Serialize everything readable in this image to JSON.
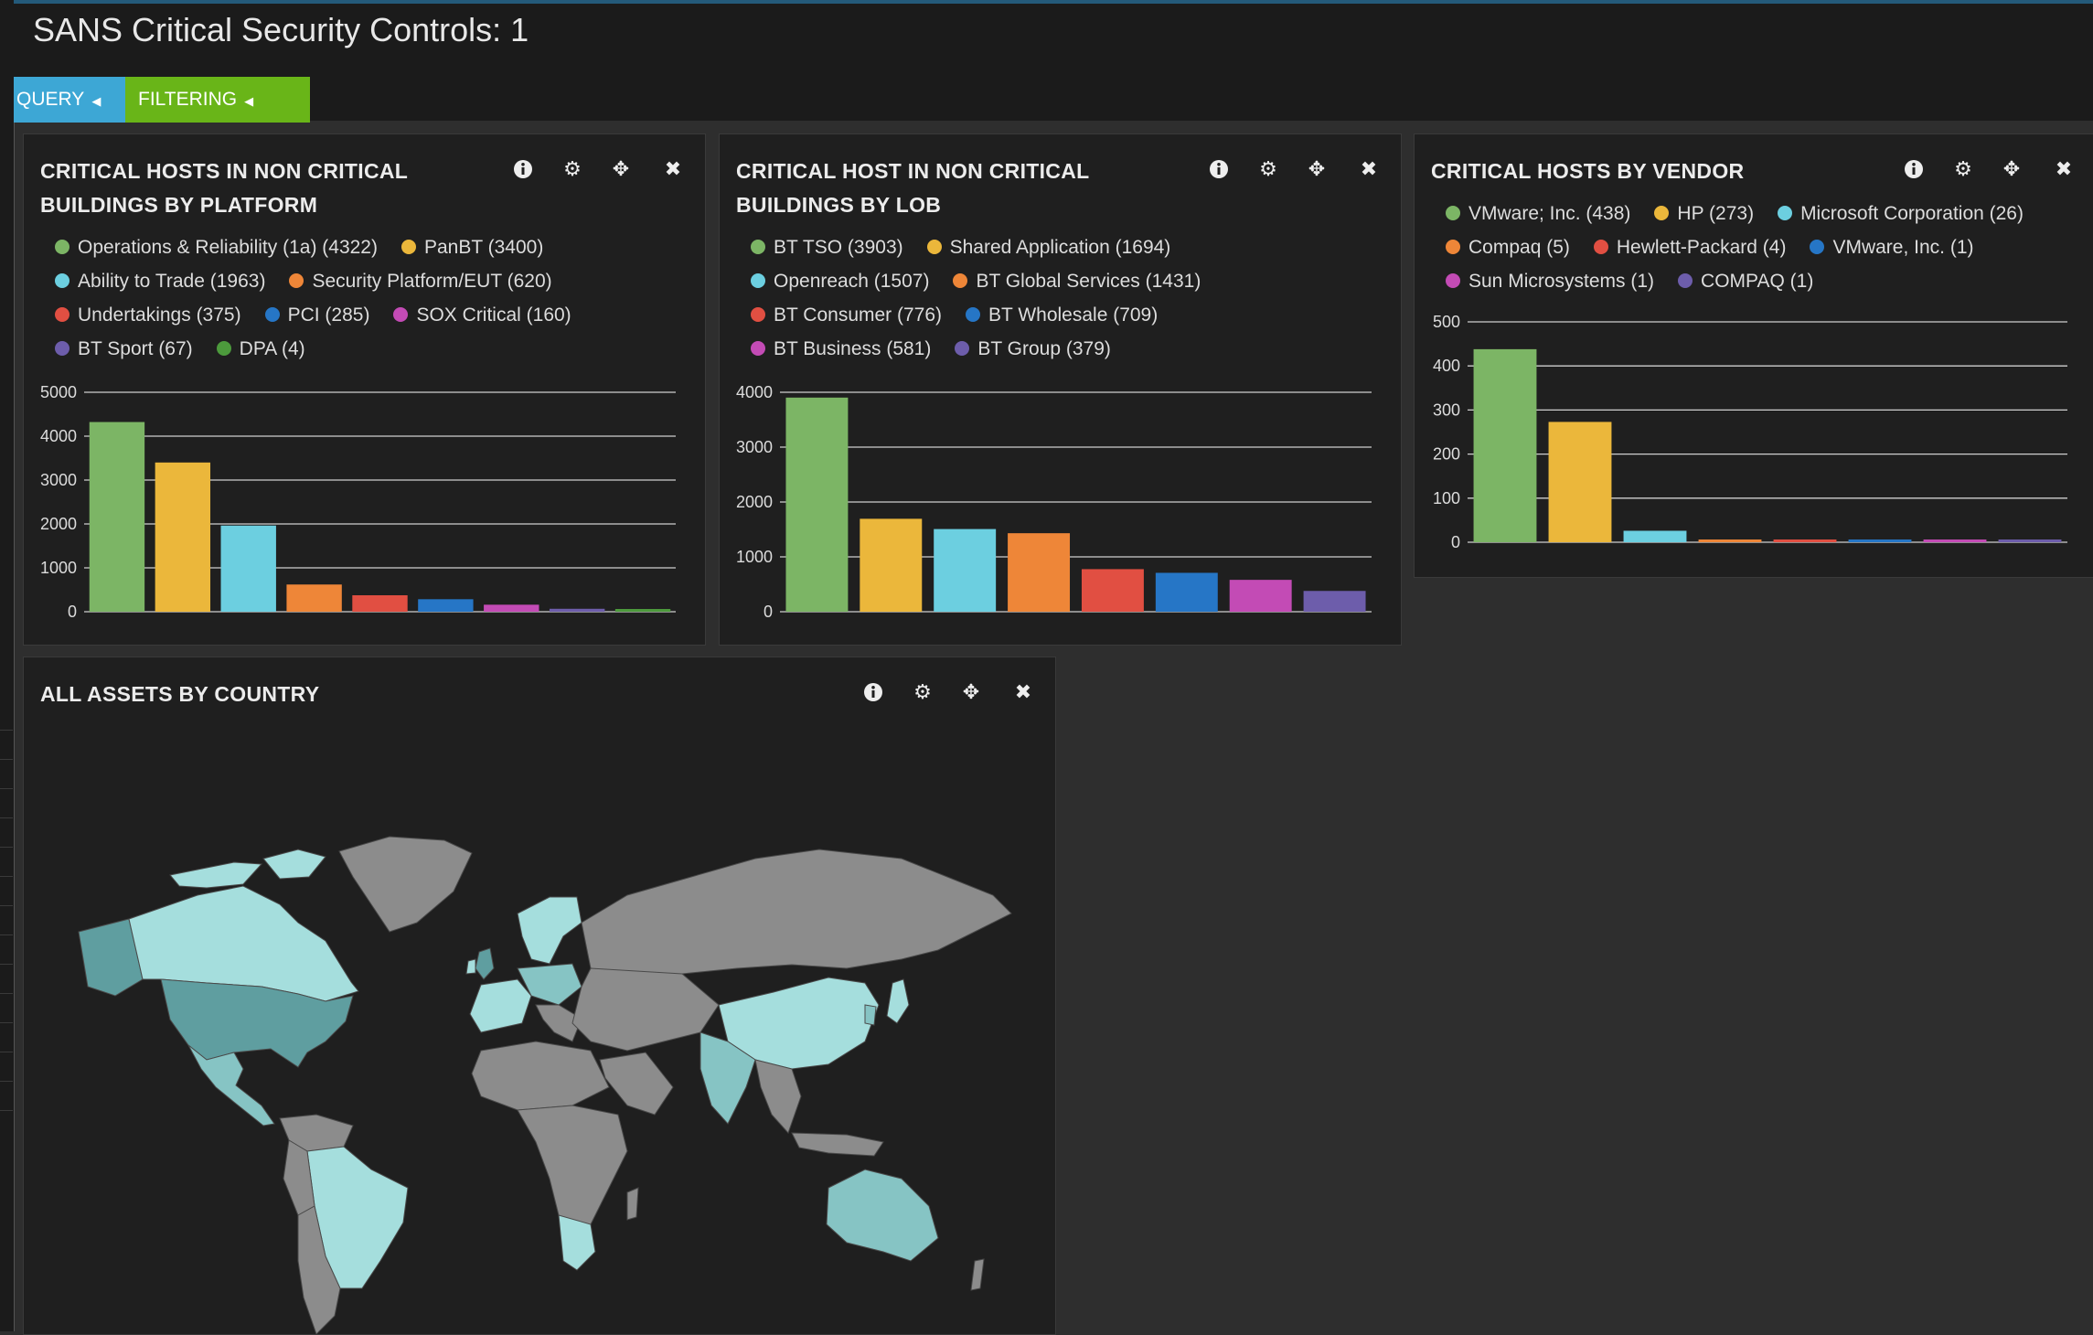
{
  "page": {
    "title": "SANS Critical Security Controls: 1"
  },
  "toolbar": {
    "query_label": "QUERY",
    "filtering_label": "FILTERING"
  },
  "colors": {
    "query": "#3da7d5",
    "filtering": "#69b518"
  },
  "panels": [
    {
      "id": "platform",
      "title_line1": "CRITICAL HOSTS IN NON CRITICAL",
      "title_line2": "BUILDINGS BY PLATFORM",
      "legend": [
        {
          "label": "Operations & Reliability (1a) (4322)",
          "color": "#7cb565"
        },
        {
          "label": "PanBT (3400)",
          "color": "#ebb73b"
        },
        {
          "label": "Ability to Trade (1963)",
          "color": "#6ccfe0"
        },
        {
          "label": "Security Platform/EUT (620)",
          "color": "#ee8638"
        },
        {
          "label": "Undertakings (375)",
          "color": "#e14f42"
        },
        {
          "label": "PCI (285)",
          "color": "#2676c6"
        },
        {
          "label": "SOX Critical (160)",
          "color": "#c34bb5"
        },
        {
          "label": "BT Sport (67)",
          "color": "#6d5dab"
        },
        {
          "label": "DPA (4)",
          "color": "#4c9a3c"
        }
      ]
    },
    {
      "id": "lob",
      "title_line1": "CRITICAL HOST IN NON CRITICAL",
      "title_line2": "BUILDINGS BY LOB",
      "legend": [
        {
          "label": "BT TSO (3903)",
          "color": "#7cb565"
        },
        {
          "label": "Shared Application (1694)",
          "color": "#ebb73b"
        },
        {
          "label": "Openreach (1507)",
          "color": "#6ccfe0"
        },
        {
          "label": "BT Global Services (1431)",
          "color": "#ee8638"
        },
        {
          "label": "BT Consumer (776)",
          "color": "#e14f42"
        },
        {
          "label": "BT Wholesale (709)",
          "color": "#2676c6"
        },
        {
          "label": "BT Business (581)",
          "color": "#c34bb5"
        },
        {
          "label": "BT Group (379)",
          "color": "#6d5dab"
        }
      ]
    },
    {
      "id": "vendor",
      "title_line1": "CRITICAL HOSTS BY VENDOR",
      "title_line2": "",
      "legend": [
        {
          "label": "VMware; Inc. (438)",
          "color": "#7cb565"
        },
        {
          "label": "HP (273)",
          "color": "#ebb73b"
        },
        {
          "label": "Microsoft Corporation (26)",
          "color": "#6ccfe0"
        },
        {
          "label": "Compaq (5)",
          "color": "#ee8638"
        },
        {
          "label": "Hewlett-Packard (4)",
          "color": "#e14f42"
        },
        {
          "label": "VMware, Inc. (1)",
          "color": "#2676c6"
        },
        {
          "label": "Sun Microsystems (1)",
          "color": "#c34bb5"
        },
        {
          "label": "COMPAQ (1)",
          "color": "#6d5dab"
        }
      ]
    },
    {
      "id": "map",
      "title_line1": "ALL ASSETS BY COUNTRY",
      "title_line2": "",
      "legend": []
    }
  ],
  "chart_data": [
    {
      "type": "bar",
      "categories": [
        "Operations & Reliability (1a)",
        "PanBT",
        "Ability to Trade",
        "Security Platform/EUT",
        "Undertakings",
        "PCI",
        "SOX Critical",
        "BT Sport",
        "DPA"
      ],
      "values": [
        4322,
        3400,
        1963,
        620,
        375,
        285,
        160,
        67,
        4
      ],
      "colors": [
        "#7cb565",
        "#ebb73b",
        "#6ccfe0",
        "#ee8638",
        "#e14f42",
        "#2676c6",
        "#c34bb5",
        "#6d5dab",
        "#4c9a3c"
      ],
      "yticks": [
        0,
        1000,
        2000,
        3000,
        4000,
        5000
      ],
      "ylim": [
        0,
        5000
      ],
      "grid": true
    },
    {
      "type": "bar",
      "categories": [
        "BT TSO",
        "Shared Application",
        "Openreach",
        "BT Global Services",
        "BT Consumer",
        "BT Wholesale",
        "BT Business",
        "BT Group"
      ],
      "values": [
        3903,
        1694,
        1507,
        1431,
        776,
        709,
        581,
        379
      ],
      "colors": [
        "#7cb565",
        "#ebb73b",
        "#6ccfe0",
        "#ee8638",
        "#e14f42",
        "#2676c6",
        "#c34bb5",
        "#6d5dab"
      ],
      "yticks": [
        0,
        1000,
        2000,
        3000,
        4000
      ],
      "ylim": [
        0,
        4000
      ],
      "grid": true
    },
    {
      "type": "bar",
      "categories": [
        "VMware; Inc.",
        "HP",
        "Microsoft Corporation",
        "Compaq",
        "Hewlett-Packard",
        "VMware, Inc.",
        "Sun Microsystems",
        "COMPAQ"
      ],
      "values": [
        438,
        273,
        26,
        5,
        4,
        1,
        1,
        1
      ],
      "colors": [
        "#7cb565",
        "#ebb73b",
        "#6ccfe0",
        "#ee8638",
        "#e14f42",
        "#2676c6",
        "#c34bb5",
        "#6d5dab"
      ],
      "yticks": [
        0,
        100,
        200,
        300,
        400,
        500
      ],
      "ylim": [
        0,
        500
      ],
      "grid": true
    }
  ],
  "map": {
    "type": "choropleth",
    "colors": {
      "land": "#8c8c8c",
      "high": "#5f9ea0",
      "medium": "#86c4c4",
      "low": "#a5dedd"
    }
  }
}
